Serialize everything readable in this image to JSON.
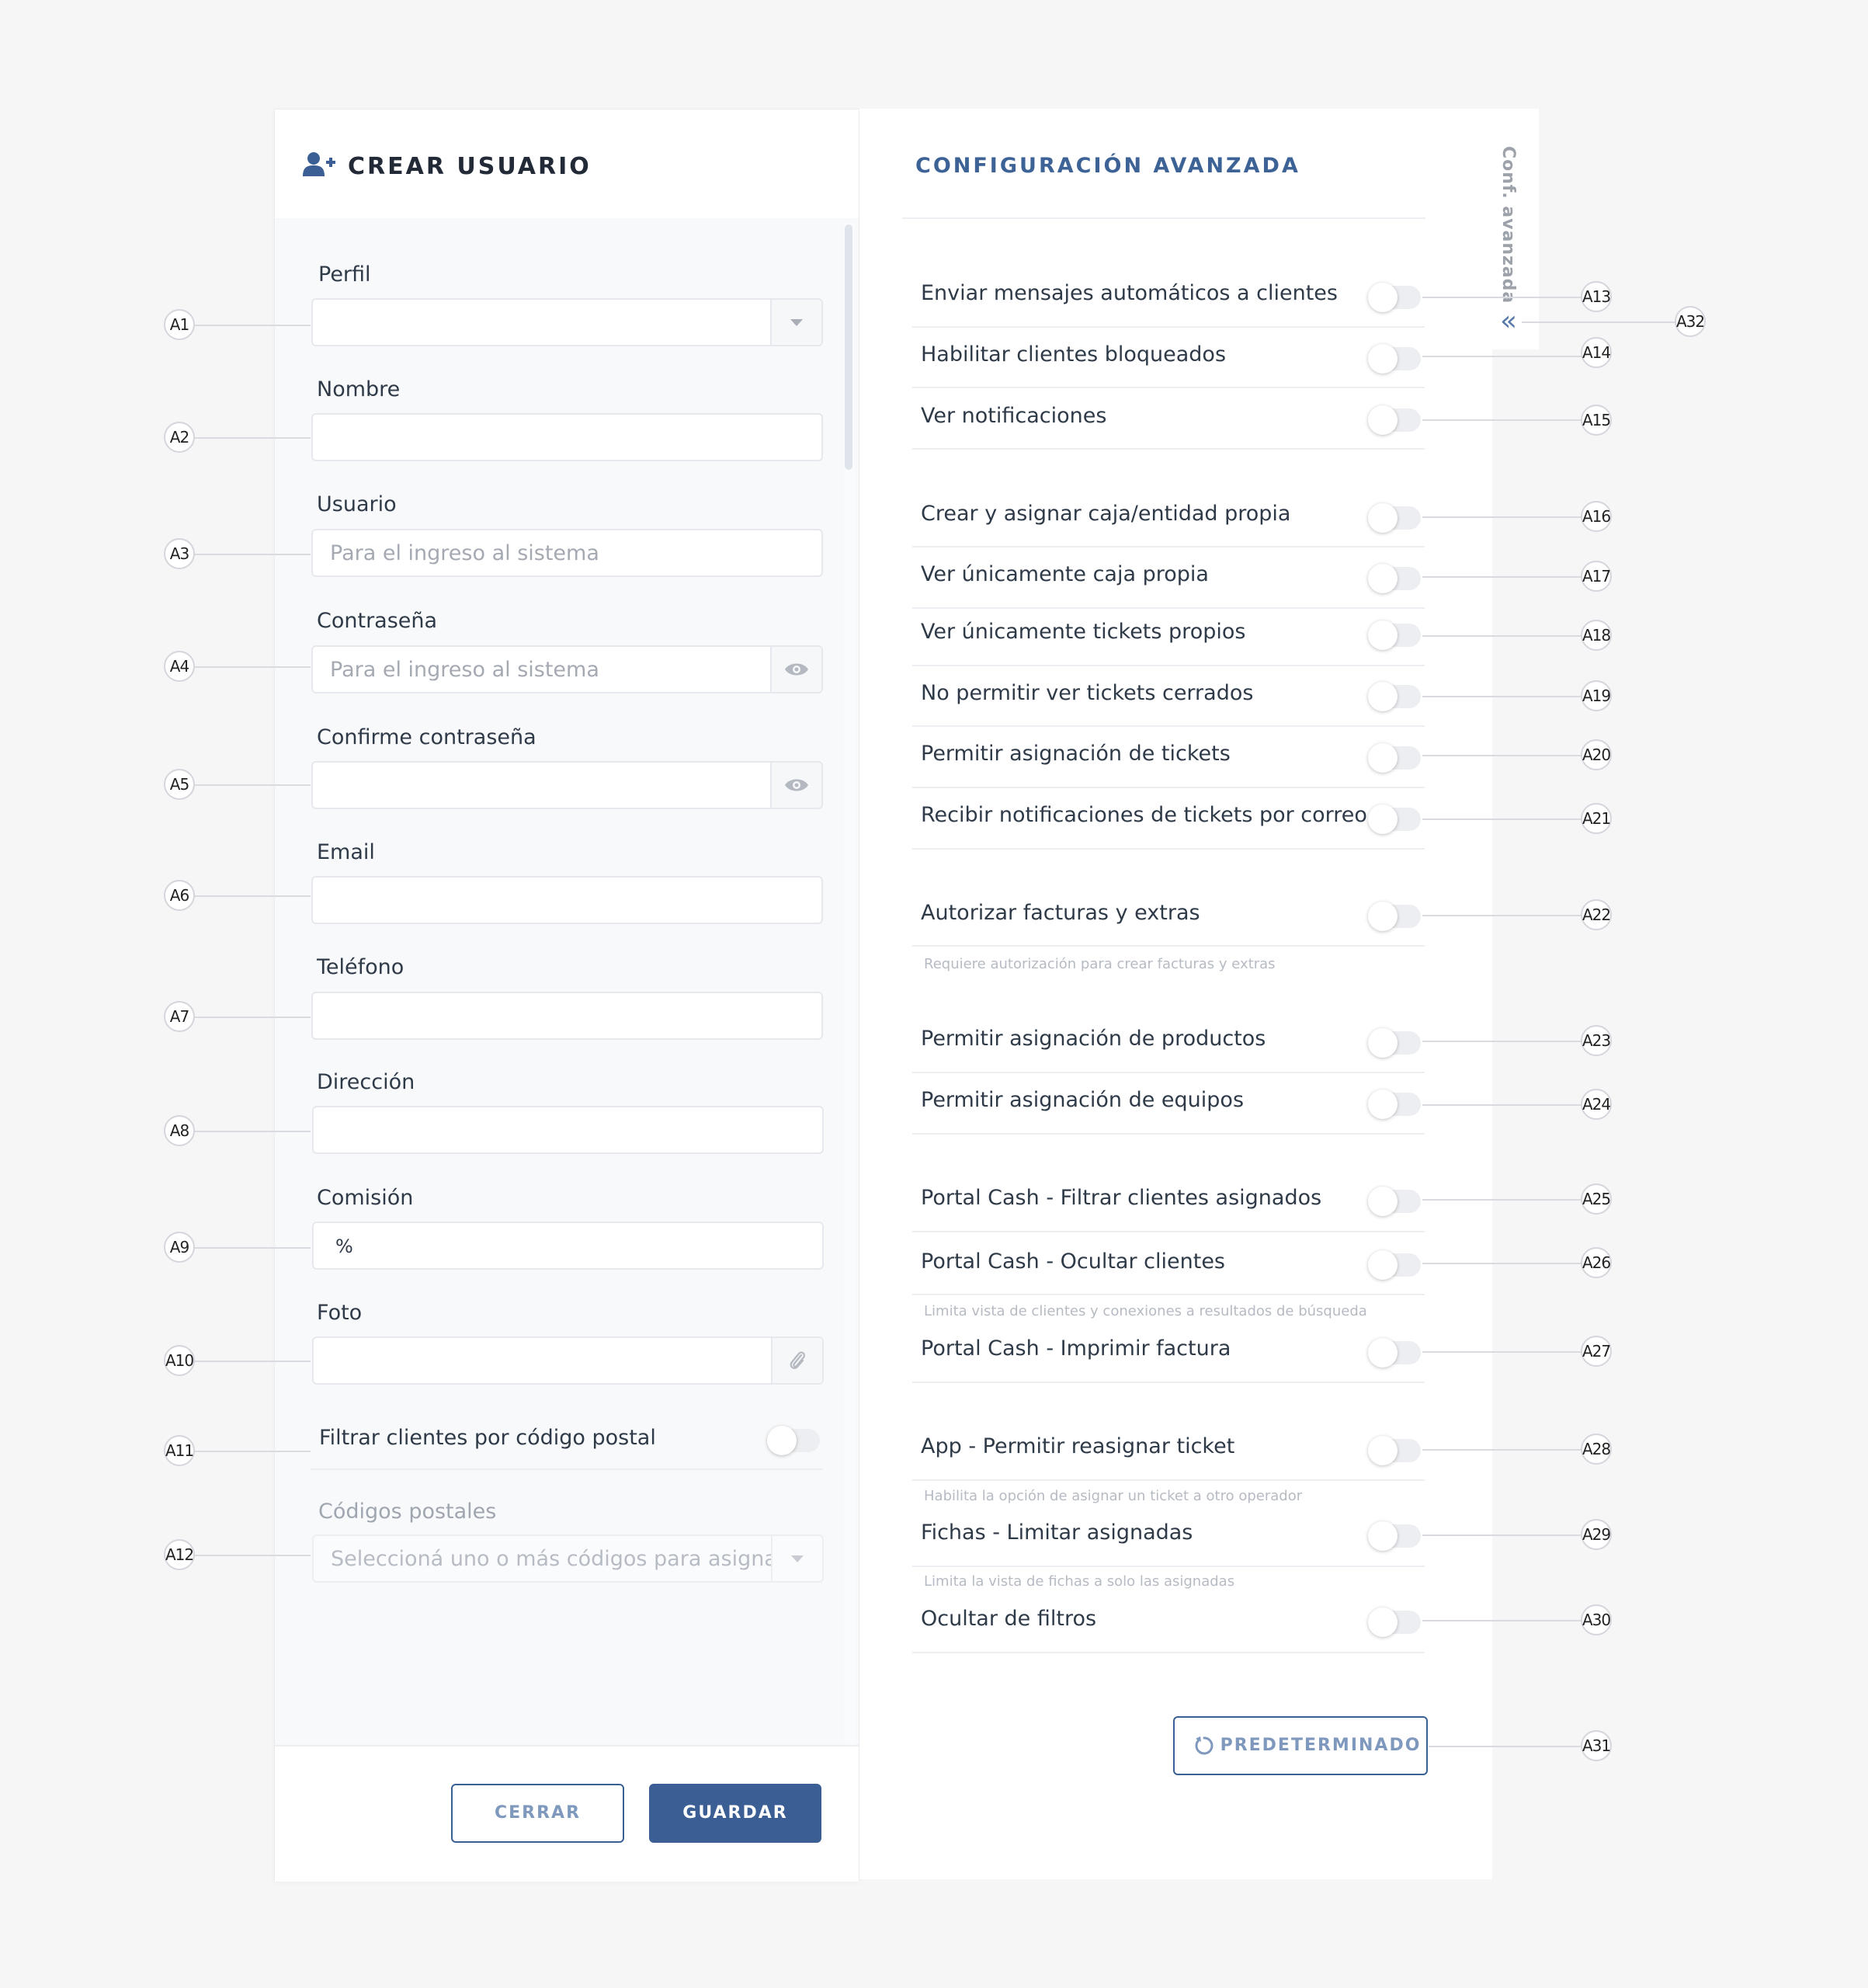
{
  "left": {
    "title": "CREAR USUARIO",
    "fields": {
      "perfil": {
        "label": "Perfil",
        "value": ""
      },
      "nombre": {
        "label": "Nombre",
        "value": ""
      },
      "usuario": {
        "label": "Usuario",
        "placeholder": "Para el ingreso al sistema"
      },
      "contrasena": {
        "label": "Contraseña",
        "placeholder": "Para el ingreso al sistema"
      },
      "confirme": {
        "label": "Confirme contraseña",
        "value": ""
      },
      "email": {
        "label": "Email",
        "value": ""
      },
      "telefono": {
        "label": "Teléfono",
        "value": ""
      },
      "direccion": {
        "label": "Dirección",
        "value": ""
      },
      "comision": {
        "label": "Comisión",
        "value": "%"
      },
      "foto": {
        "label": "Foto",
        "value": ""
      },
      "filtrar_cp": {
        "label": "Filtrar clientes por código postal",
        "on": false
      },
      "codigos": {
        "label": "Códigos postales",
        "placeholder": "Seleccioná uno o más códigos para asignar"
      }
    },
    "buttons": {
      "cerrar": "CERRAR",
      "guardar": "GUARDAR"
    }
  },
  "right": {
    "title": "CONFIGURACIÓN AVANZADA",
    "tab_label": "Conf. avanzada",
    "chevron": "«",
    "options": [
      {
        "label": "Enviar mensajes automáticos a clientes",
        "on": false
      },
      {
        "label": "Habilitar clientes bloqueados",
        "on": false
      },
      {
        "label": "Ver notificaciones",
        "on": false
      },
      {
        "label": "Crear y asignar caja/entidad propia",
        "on": false
      },
      {
        "label": "Ver únicamente caja propia",
        "on": false
      },
      {
        "label": "Ver únicamente tickets propios",
        "on": false
      },
      {
        "label": "No permitir ver tickets cerrados",
        "on": false
      },
      {
        "label": "Permitir asignación de tickets",
        "on": false
      },
      {
        "label": "Recibir notificaciones de tickets por correo",
        "on": false
      },
      {
        "label": "Autorizar facturas  y extras",
        "on": false,
        "help": "Requiere autorización para crear facturas y extras"
      },
      {
        "label": "Permitir asignación de productos",
        "on": false
      },
      {
        "label": "Permitir asignación de equipos",
        "on": false
      },
      {
        "label": "Portal Cash - Filtrar clientes asignados",
        "on": false
      },
      {
        "label": "Portal Cash - Ocultar clientes",
        "on": false,
        "help": "Limita vista de clientes y conexiones a resultados de búsqueda"
      },
      {
        "label": "Portal Cash - Imprimir factura",
        "on": false
      },
      {
        "label": "App - Permitir reasignar ticket",
        "on": false,
        "help": "Habilita la opción de asignar un ticket a otro operador"
      },
      {
        "label": "Fichas - Limitar asignadas",
        "on": false,
        "help": "Limita la vista de fichas a solo las asignadas"
      },
      {
        "label": "Ocultar de filtros",
        "on": false
      }
    ],
    "reset_button": "PREDETERMINADO"
  },
  "callouts": [
    "A1",
    "A2",
    "A3",
    "A4",
    "A5",
    "A6",
    "A7",
    "A8",
    "A9",
    "A10",
    "A11",
    "A12",
    "A13",
    "A14",
    "A15",
    "A16",
    "A17",
    "A18",
    "A19",
    "A20",
    "A21",
    "A22",
    "A23",
    "A24",
    "A25",
    "A26",
    "A27",
    "A28",
    "A29",
    "A30",
    "A31",
    "A32"
  ],
  "colors": {
    "accent": "#3b5f94",
    "title_blue": "#3d6396",
    "background": "#f6f6f7"
  }
}
